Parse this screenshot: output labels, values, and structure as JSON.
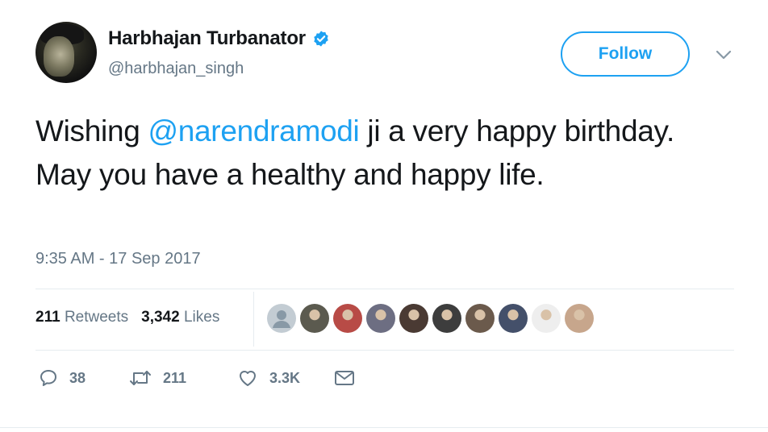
{
  "user": {
    "name": "Harbhajan Turbanator",
    "handle": "@harbhajan_singh",
    "verified": true
  },
  "follow_label": "Follow",
  "tweet": {
    "text_before": "Wishing ",
    "mention": "@narendramodi",
    "text_after": " ji a very happy birthday. May you have a healthy and happy life."
  },
  "timestamp": "9:35 AM - 17 Sep 2017",
  "stats": {
    "retweets_count": "211",
    "retweets_label": "Retweets",
    "likes_count": "3,342",
    "likes_label": "Likes"
  },
  "likers": [
    {
      "name": "default-avatar",
      "color": "#c3ccd3"
    },
    {
      "name": "avatar-2",
      "color": "#5b5a4f"
    },
    {
      "name": "avatar-3",
      "color": "#b84b46"
    },
    {
      "name": "avatar-4",
      "color": "#6d6e82"
    },
    {
      "name": "avatar-5",
      "color": "#4a3a33"
    },
    {
      "name": "avatar-6",
      "color": "#3d3d3d"
    },
    {
      "name": "avatar-7",
      "color": "#6b5a4c"
    },
    {
      "name": "avatar-8",
      "color": "#44506a"
    },
    {
      "name": "avatar-9",
      "color": "#eeeeee"
    },
    {
      "name": "avatar-10",
      "color": "#c7a68c"
    }
  ],
  "actions": {
    "replies": "38",
    "retweets": "211",
    "likes": "3.3K"
  },
  "colors": {
    "accent": "#1da1f2",
    "text": "#14171a",
    "muted": "#657786",
    "border": "#e6ecf0"
  },
  "icons": [
    "verified-badge-icon",
    "chevron-down-icon",
    "reply-icon",
    "retweet-icon",
    "heart-icon",
    "mail-icon"
  ]
}
